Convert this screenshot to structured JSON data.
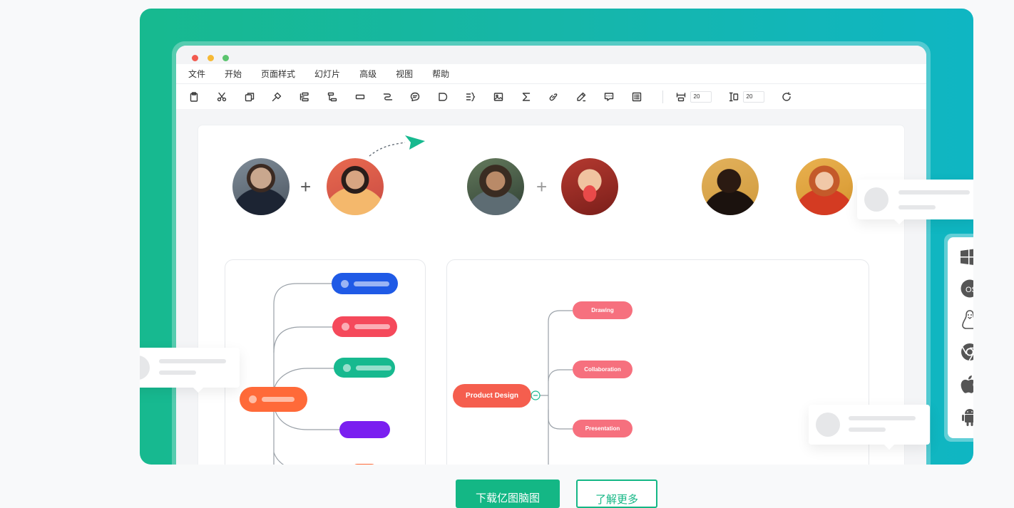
{
  "menu": {
    "items": [
      "文件",
      "开始",
      "页面样式",
      "幻灯片",
      "高级",
      "视图",
      "帮助"
    ]
  },
  "toolbar": {
    "icons": [
      "clipboard-icon",
      "cut-icon",
      "copy-icon",
      "format-painter-icon",
      "insert-topic-icon",
      "insert-subtopic-icon",
      "floating-topic-icon",
      "relationship-icon",
      "callout-icon",
      "boundary-icon",
      "summary-icon",
      "image-icon",
      "formula-icon",
      "link-icon",
      "pen-icon",
      "comment-icon",
      "note-icon"
    ],
    "horizontal_spacing": "20",
    "vertical_spacing": "20"
  },
  "mindmap": {
    "root": "Product Design",
    "children": [
      "Drawing",
      "Collaboration",
      "Presentation"
    ]
  },
  "colors": {
    "brand": "#14b785",
    "pill_blue": "#1f5ae6",
    "pill_red": "#f5495b",
    "pill_teal": "#17b98f",
    "pill_purple": "#7a1ff0",
    "pill_orange": "#ff6a39",
    "node_pink": "#f6707e",
    "root_red": "#f55e4e"
  },
  "os_icons": [
    "windows-icon",
    "macos-icon",
    "linux-icon",
    "chrome-icon",
    "apple-icon",
    "android-icon"
  ],
  "os_labels": {
    "macos": "OS"
  },
  "cta": {
    "primary": "下载亿图脑图",
    "secondary": "了解更多"
  }
}
